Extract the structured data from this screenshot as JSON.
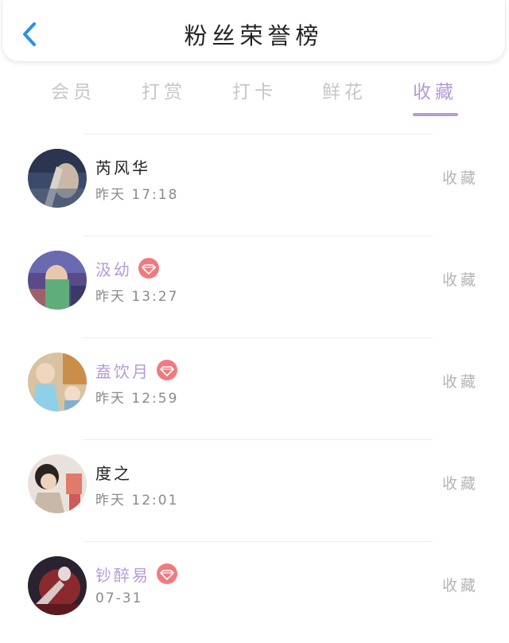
{
  "header": {
    "title": "粉丝荣誉榜",
    "back_icon": "chevron-left-icon",
    "accent": "#2b8ef0"
  },
  "tabs": [
    {
      "label": "会员",
      "active": false
    },
    {
      "label": "打赏",
      "active": false
    },
    {
      "label": "打卡",
      "active": false
    },
    {
      "label": "鲜花",
      "active": false
    },
    {
      "label": "收藏",
      "active": true
    }
  ],
  "colors": {
    "active_tab": "#b79ad6",
    "vip_name": "#b79ad6",
    "vip_badge": "#f07a7f"
  },
  "list": [
    {
      "name": "芮风华",
      "vip": false,
      "time": "昨天 17:18",
      "action": "收藏"
    },
    {
      "name": "汲幼",
      "vip": true,
      "time": "昨天 13:27",
      "action": "收藏"
    },
    {
      "name": "盍饮月",
      "vip": true,
      "time": "昨天 12:59",
      "action": "收藏"
    },
    {
      "name": "度之",
      "vip": false,
      "time": "昨天 12:01",
      "action": "收藏"
    },
    {
      "name": "钞醉易",
      "vip": true,
      "time": "07-31",
      "action": "收藏"
    }
  ]
}
